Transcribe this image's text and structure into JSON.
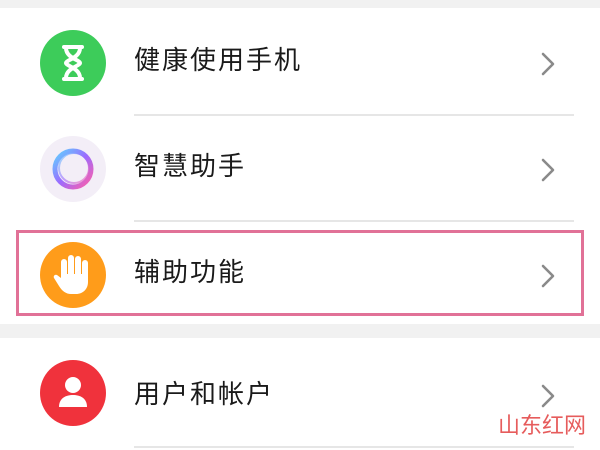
{
  "settings_list": {
    "items": [
      {
        "label": "健康使用手机",
        "icon": "hourglass-icon",
        "icon_color": "#3dcc5a"
      },
      {
        "label": "智慧助手",
        "icon": "assistant-orb-icon",
        "icon_color": "#9b7bff"
      },
      {
        "label": "辅助功能",
        "icon": "hand-icon",
        "icon_color": "#ff9c1a"
      },
      {
        "label": "用户和帐户",
        "icon": "user-icon",
        "icon_color": "#f0323c"
      }
    ],
    "chevron_icon": "chevron-right-icon"
  },
  "highlight_color": "#e17197",
  "watermark": "山东红网"
}
